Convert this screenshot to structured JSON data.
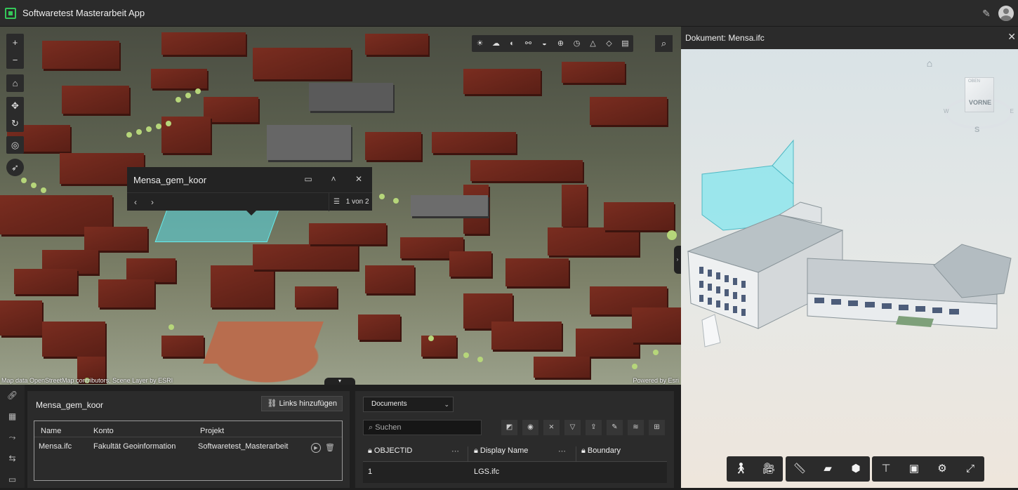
{
  "app": {
    "title": "Softwaretest Masterarbeit App",
    "edit_icon": "pencil-icon",
    "user_icon": "avatar-icon"
  },
  "map": {
    "attribution_left": "Map data OpenStreetMap contributors, Scene Layer by ESRI",
    "attribution_right": "Powered by Esri",
    "controls": [
      "+",
      "−"
    ],
    "popup": {
      "title": "Mensa_gem_koor",
      "count": "1 von 2",
      "prev": "‹",
      "next": "›"
    }
  },
  "attachments": {
    "title": "Mensa_gem_koor",
    "add_links_label": "Links hinzufügen",
    "columns": [
      "Name",
      "Konto",
      "Projekt"
    ],
    "rows": [
      {
        "name": "Mensa.ifc",
        "konto": "Fakultät Geoinformation",
        "projekt": "Softwaretest_Masterarbeit"
      }
    ]
  },
  "table": {
    "layer_select": "Documents",
    "search_placeholder": "Suchen",
    "columns": [
      "OBJECTID",
      "Display Name",
      "Boundary"
    ],
    "rows": [
      {
        "objectid": "1",
        "display_name": "LGS.ifc",
        "boundary": ""
      }
    ]
  },
  "viewer": {
    "title": "Dokument: Mensa.ifc",
    "cube_top": "OBEN",
    "cube_front": "VORNE",
    "compass_s": "S",
    "compass_w": "W",
    "compass_e": "E"
  },
  "colors": {
    "accent": "#35c759",
    "roof": "#6b251a",
    "highlight": "#5ad6e0"
  }
}
